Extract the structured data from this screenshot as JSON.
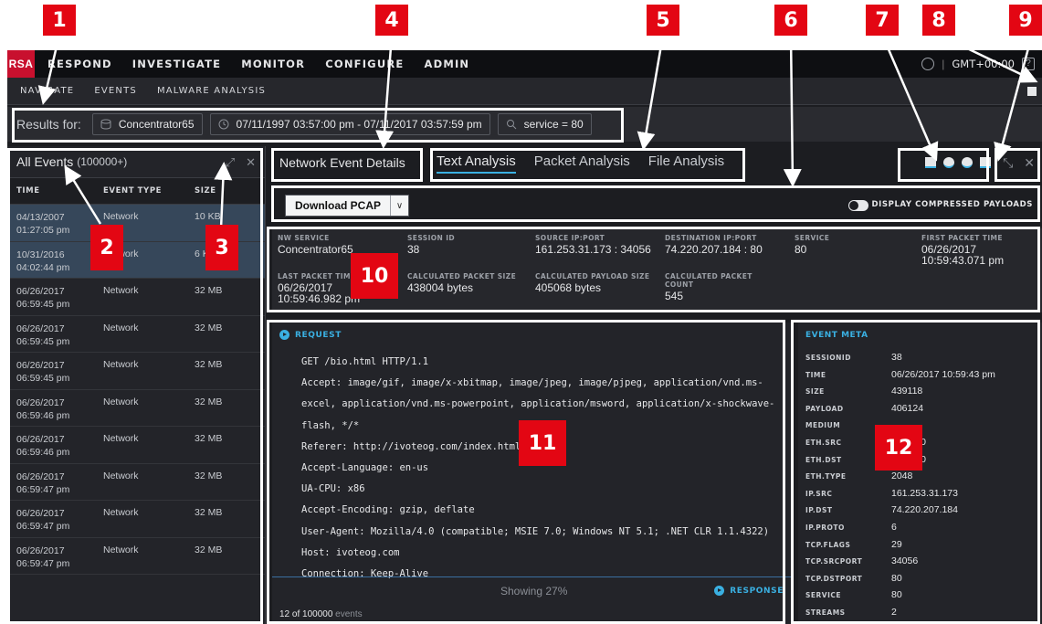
{
  "callouts": [
    "1",
    "2",
    "3",
    "4",
    "5",
    "6",
    "7",
    "8",
    "9",
    "10",
    "11",
    "12"
  ],
  "topnav": {
    "logo": "RSA",
    "items": [
      "RESPOND",
      "INVESTIGATE",
      "MONITOR",
      "CONFIGURE",
      "ADMIN"
    ],
    "timezone": "GMT+00:00",
    "help": "?"
  },
  "subnav": {
    "items": [
      "NAVIGATE",
      "EVENTS",
      "MALWARE ANALYSIS"
    ]
  },
  "results": {
    "label": "Results for:",
    "service": "Concentrator65",
    "time_range": "07/11/1997 03:57:00 pm - 07/11/2017 03:57:59 pm",
    "query": "service = 80"
  },
  "events_panel": {
    "title": "All Events",
    "count": "(100000+)",
    "columns": [
      "TIME",
      "EVENT TYPE",
      "SIZE"
    ],
    "rows": [
      {
        "date": "04/13/2007",
        "time": "01:27:05 pm",
        "type": "Network",
        "size": "10 KB"
      },
      {
        "date": "10/31/2016",
        "time": "04:02:44 pm",
        "type": "Network",
        "size": "6 KB"
      },
      {
        "date": "06/26/2017",
        "time": "06:59:45 pm",
        "type": "Network",
        "size": "32 MB"
      },
      {
        "date": "06/26/2017",
        "time": "06:59:45 pm",
        "type": "Network",
        "size": "32 MB"
      },
      {
        "date": "06/26/2017",
        "time": "06:59:45 pm",
        "type": "Network",
        "size": "32 MB"
      },
      {
        "date": "06/26/2017",
        "time": "06:59:46 pm",
        "type": "Network",
        "size": "32 MB"
      },
      {
        "date": "06/26/2017",
        "time": "06:59:46 pm",
        "type": "Network",
        "size": "32 MB"
      },
      {
        "date": "06/26/2017",
        "time": "06:59:47 pm",
        "type": "Network",
        "size": "32 MB"
      },
      {
        "date": "06/26/2017",
        "time": "06:59:47 pm",
        "type": "Network",
        "size": "32 MB"
      },
      {
        "date": "06/26/2017",
        "time": "06:59:47 pm",
        "type": "Network",
        "size": "32 MB"
      }
    ]
  },
  "details": {
    "title": "Network Event Details",
    "tabs": [
      "Text Analysis",
      "Packet Analysis",
      "File Analysis"
    ],
    "active_tab": "Text Analysis",
    "download_label": "Download PCAP",
    "toggle_label": "DISPLAY COMPRESSED PAYLOADS"
  },
  "event_header": {
    "nw_service_label": "NW SERVICE",
    "nw_service": "Concentrator65",
    "session_id_label": "SESSION ID",
    "session_id": "38",
    "source_label": "SOURCE IP:PORT",
    "source": "161.253.31.173 : 34056",
    "dest_label": "DESTINATION IP:PORT",
    "dest": "74.220.207.184 : 80",
    "service_label": "SERVICE",
    "service": "80",
    "first_time_label": "FIRST PACKET TIME",
    "first_time_date": "06/26/2017",
    "first_time_clock": "10:59:43.071 pm",
    "last_time_label": "LAST PACKET TIME",
    "last_time_date": "06/26/2017",
    "last_time_clock": "10:59:46.982 pm",
    "packet_size_label": "CALCULATED PACKET SIZE",
    "packet_size": "438004 bytes",
    "payload_size_label": "CALCULATED PAYLOAD SIZE",
    "payload_size": "405068 bytes",
    "packet_count_label": "CALCULATED PACKET COUNT",
    "packet_count": "545"
  },
  "request": {
    "label": "REQUEST",
    "text": "GET /bio.html HTTP/1.1\nAccept: image/gif, image/x-xbitmap, image/jpeg, image/pjpeg, application/vnd.ms-excel, application/vnd.ms-powerpoint, application/msword, application/x-shockwave-flash, */*\nReferer: http://ivoteog.com/index.html\nAccept-Language: en-us\nUA-CPU: x86\nAccept-Encoding: gzip, deflate\nUser-Agent: Mozilla/4.0 (compatible; MSIE 7.0; Windows NT 5.1; .NET CLR 1.1.4322)\nHost: ivoteog.com\nConnection: Keep-Alive",
    "showing": "Showing 27%",
    "response_label": "RESPONSE",
    "event_count": "12 of 100000",
    "event_count_suffix": "events"
  },
  "event_meta": {
    "title": "EVENT META",
    "rows": [
      {
        "key": "SESSIONID",
        "value": "38"
      },
      {
        "key": "TIME",
        "value": "06/26/2017 10:59:43 pm"
      },
      {
        "key": "SIZE",
        "value": "439118"
      },
      {
        "key": "PAYLOAD",
        "value": "406124"
      },
      {
        "key": "MEDIUM",
        "value": ""
      },
      {
        "key": "ETH.SRC",
        "value": "B:C8:00"
      },
      {
        "key": "ETH.DST",
        "value": "B:C7:00"
      },
      {
        "key": "ETH.TYPE",
        "value": "2048"
      },
      {
        "key": "IP.SRC",
        "value": "161.253.31.173"
      },
      {
        "key": "IP.DST",
        "value": "74.220.207.184"
      },
      {
        "key": "IP.PROTO",
        "value": "6"
      },
      {
        "key": "TCP.FLAGS",
        "value": "29"
      },
      {
        "key": "TCP.SRCPORT",
        "value": "34056"
      },
      {
        "key": "TCP.DSTPORT",
        "value": "80"
      },
      {
        "key": "SERVICE",
        "value": "80"
      },
      {
        "key": "STREAMS",
        "value": "2"
      }
    ]
  },
  "colors": {
    "accent": "#3ab0e2",
    "callout": "#e30613",
    "brand": "#c8102e"
  }
}
